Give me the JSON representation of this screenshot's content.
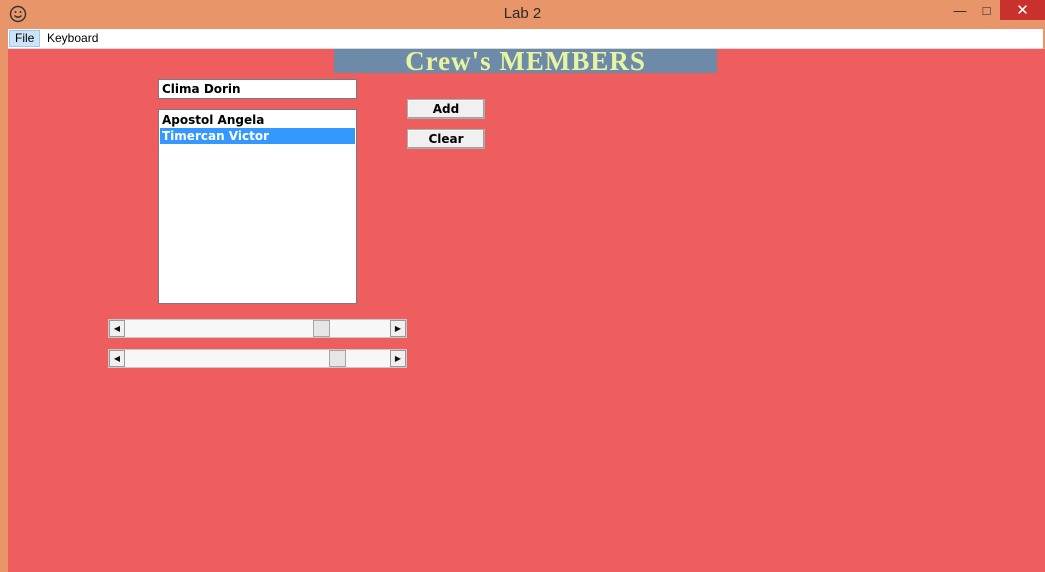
{
  "window": {
    "title": "Lab 2",
    "app_icon": "smiley-face-icon",
    "controls": {
      "minimize": "—",
      "maximize": "□",
      "close": "✕"
    }
  },
  "menu": {
    "items": [
      {
        "label": "File"
      },
      {
        "label": "Keyboard"
      }
    ]
  },
  "banner": {
    "text": "Crew's MEMBERS"
  },
  "name_input": {
    "value": "Clima Dorin"
  },
  "members_list": {
    "items": [
      {
        "label": "Apostol Angela",
        "selected": false
      },
      {
        "label": "Timercan Victor",
        "selected": true
      }
    ]
  },
  "buttons": {
    "add_label": "Add",
    "clear_label": "Clear"
  },
  "scrollbars": [
    {
      "position_fraction": 0.74
    },
    {
      "position_fraction": 0.8
    }
  ],
  "colors": {
    "client_background": "#ef5e5e",
    "frame": "#e8956a",
    "banner_background": "#6d8aa8",
    "banner_text": "#e8f5a0",
    "selection": "#3399ff"
  }
}
